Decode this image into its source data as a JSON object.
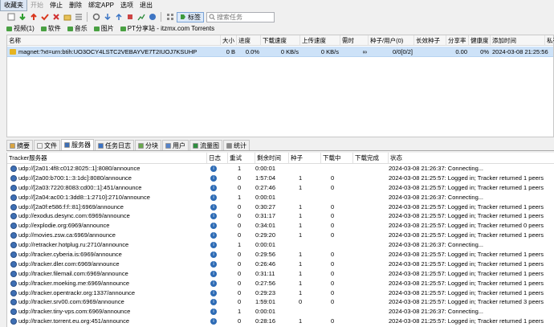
{
  "menu": [
    "收藏夹",
    "开始",
    "停止",
    "删除",
    "绑定APP",
    "选项",
    "退出"
  ],
  "toolbar": {
    "tag_label": "标签",
    "search_placeholder": "搜索任务"
  },
  "categories": [
    {
      "label": "视频(1)"
    },
    {
      "label": "软件"
    },
    {
      "label": "音乐"
    },
    {
      "label": "图片"
    },
    {
      "label": "PT分享站 - itzmx.com Torrents"
    }
  ],
  "task_columns": [
    "名称",
    "大小",
    "进度",
    "下载速度",
    "上传速度",
    "需时",
    "种子/用户(0)",
    "长效种子",
    "分享率",
    "健康度",
    "添加时间",
    "私有"
  ],
  "task": {
    "name": "magnet:?xt=urn:btih:UO3OCY4LSTC2VEBAYVE7T2IUOJ7KSUHP",
    "size": "0 B",
    "progress": "0.0%",
    "download_speed": "0 KB/s",
    "upload_speed": "0 KB/s",
    "eta": "∞",
    "seeds_peers": "0/0[0/2]",
    "ratio": "0.00",
    "health": "0%",
    "added": "2024-03-08 21:25:56"
  },
  "detail_tabs": [
    {
      "label": "摘要",
      "color": "#d9a441"
    },
    {
      "label": "文件",
      "color": "#f2f2f2"
    },
    {
      "label": "服务器",
      "color": "#3e6fb4"
    },
    {
      "label": "任务日志",
      "color": "#3b73c5"
    },
    {
      "label": "分块",
      "color": "#6aa84f"
    },
    {
      "label": "用户",
      "color": "#5683c9"
    },
    {
      "label": "流量图",
      "color": "#2f8f3f"
    },
    {
      "label": "统计",
      "color": "#888888"
    }
  ],
  "tracker_columns": [
    "Tracker服务器",
    "日志",
    "重试",
    "剩余时间",
    "种子",
    "下载中",
    "下载完成",
    "状态"
  ],
  "trackers": [
    {
      "url": "udp://[2a01:4f8:c012:8025::1]:8080/announce",
      "retry": "1",
      "remaining": "0:00:01",
      "seeds": "",
      "leechers": "",
      "status": "2024-03-08 21:26:37: Connecting..."
    },
    {
      "url": "udp://[2a00:b700:1::3:1dc]:8080/announce",
      "retry": "0",
      "remaining": "1:57:04",
      "seeds": "1",
      "leechers": "0",
      "status": "2024-03-08 21:25:57: Logged in; Tracker returned 1 peers"
    },
    {
      "url": "udp://[2a03:7220:8083:cd00::1]:451/announce",
      "retry": "0",
      "remaining": "0:27:46",
      "seeds": "1",
      "leechers": "0",
      "status": "2024-03-08 21:25:57: Logged in; Tracker returned 1 peers"
    },
    {
      "url": "udp://[2a04:ac00:1:3dd8::1:2710]:2710/announce",
      "retry": "1",
      "remaining": "0:00:01",
      "seeds": "",
      "leechers": "",
      "status": "2024-03-08 21:26:37: Connecting..."
    },
    {
      "url": "udp://[2a0f:e586:f:f::81]:6969/announce",
      "retry": "0",
      "remaining": "0:30:27",
      "seeds": "1",
      "leechers": "0",
      "status": "2024-03-08 21:25:57: Logged in; Tracker returned 1 peers"
    },
    {
      "url": "udp://exodus.desync.com:6969/announce",
      "retry": "0",
      "remaining": "0:31:17",
      "seeds": "1",
      "leechers": "0",
      "status": "2024-03-08 21:25:57: Logged in; Tracker returned 1 peers"
    },
    {
      "url": "udp://explodie.org:6969/announce",
      "retry": "0",
      "remaining": "0:34:01",
      "seeds": "1",
      "leechers": "0",
      "status": "2024-03-08 21:25:57: Logged in; Tracker returned 0 peers"
    },
    {
      "url": "udp://movies.zsw.ca:6969/announce",
      "retry": "0",
      "remaining": "0:29:20",
      "seeds": "1",
      "leechers": "0",
      "status": "2024-03-08 21:25:57: Logged in; Tracker returned 1 peers"
    },
    {
      "url": "udp://retracker.hotplug.ru:2710/announce",
      "retry": "1",
      "remaining": "0:00:01",
      "seeds": "",
      "leechers": "",
      "status": "2024-03-08 21:26:37: Connecting..."
    },
    {
      "url": "udp://tracker.cyberia.is:6969/announce",
      "retry": "0",
      "remaining": "0:29:56",
      "seeds": "1",
      "leechers": "0",
      "status": "2024-03-08 21:25:57: Logged in; Tracker returned 1 peers"
    },
    {
      "url": "udp://tracker.dler.com:6969/announce",
      "retry": "0",
      "remaining": "0:26:46",
      "seeds": "1",
      "leechers": "0",
      "status": "2024-03-08 21:25:57: Logged in; Tracker returned 1 peers"
    },
    {
      "url": "udp://tracker.filemail.com:6969/announce",
      "retry": "0",
      "remaining": "0:31:11",
      "seeds": "1",
      "leechers": "0",
      "status": "2024-03-08 21:25:57: Logged in; Tracker returned 1 peers"
    },
    {
      "url": "udp://tracker.moeking.me:6969/announce",
      "retry": "0",
      "remaining": "0:27:56",
      "seeds": "1",
      "leechers": "0",
      "status": "2024-03-08 21:25:57: Logged in; Tracker returned 1 peers"
    },
    {
      "url": "udp://tracker.opentrackr.org:1337/announce",
      "retry": "0",
      "remaining": "0:29:23",
      "seeds": "1",
      "leechers": "0",
      "status": "2024-03-08 21:25:57: Logged in; Tracker returned 1 peers"
    },
    {
      "url": "udp://tracker.srv00.com:6969/announce",
      "retry": "0",
      "remaining": "1:59:01",
      "seeds": "0",
      "leechers": "0",
      "status": "2024-03-08 21:25:57: Logged in; Tracker returned 3 peers"
    },
    {
      "url": "udp://tracker.tiny-vps.com:6969/announce",
      "retry": "1",
      "remaining": "0:00:01",
      "seeds": "",
      "leechers": "",
      "status": "2024-03-08 21:26:37: Connecting..."
    },
    {
      "url": "udp://tracker.torrent.eu.org:451/announce",
      "retry": "0",
      "remaining": "0:28:16",
      "seeds": "1",
      "leechers": "0",
      "status": "2024-03-08 21:25:57: Logged in; Tracker returned 1 peers"
    }
  ]
}
